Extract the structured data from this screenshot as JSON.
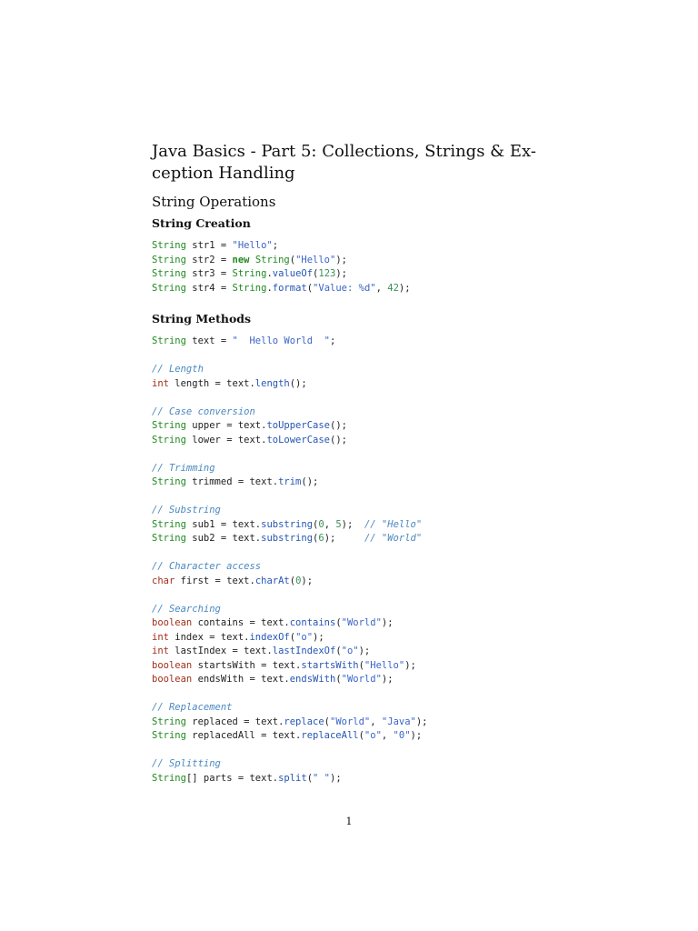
{
  "document": {
    "title_lines": [
      "Java Basics - Part 5: Collections, Strings & Ex-",
      "ception Handling"
    ],
    "section_title": "String Operations",
    "subsections": [
      {
        "heading": "String Creation",
        "code_lines": [
          [
            [
              "type",
              "String"
            ],
            [
              "pl",
              " str1 = "
            ],
            [
              "str",
              "\"Hello\""
            ],
            [
              "pl",
              ";"
            ]
          ],
          [
            [
              "type",
              "String"
            ],
            [
              "pl",
              " str2 = "
            ],
            [
              "kw",
              "new"
            ],
            [
              "pl",
              " "
            ],
            [
              "type",
              "String"
            ],
            [
              "pl",
              "("
            ],
            [
              "str",
              "\"Hello\""
            ],
            [
              "pl",
              ");"
            ]
          ],
          [
            [
              "type",
              "String"
            ],
            [
              "pl",
              " str3 = "
            ],
            [
              "type",
              "String"
            ],
            [
              "pl",
              "."
            ],
            [
              "fn",
              "valueOf"
            ],
            [
              "pl",
              "("
            ],
            [
              "num",
              "123"
            ],
            [
              "pl",
              ");"
            ]
          ],
          [
            [
              "type",
              "String"
            ],
            [
              "pl",
              " str4 = "
            ],
            [
              "type",
              "String"
            ],
            [
              "pl",
              "."
            ],
            [
              "fn",
              "format"
            ],
            [
              "pl",
              "("
            ],
            [
              "str",
              "\"Value: %d\""
            ],
            [
              "pl",
              ", "
            ],
            [
              "num",
              "42"
            ],
            [
              "pl",
              ");"
            ]
          ]
        ]
      },
      {
        "heading": "String Methods",
        "code_lines": [
          [
            [
              "type",
              "String"
            ],
            [
              "pl",
              " text = "
            ],
            [
              "str",
              "\"  Hello World  \""
            ],
            [
              "pl",
              ";"
            ]
          ],
          [],
          [
            [
              "com",
              "// Length"
            ]
          ],
          [
            [
              "prim",
              "int"
            ],
            [
              "pl",
              " length = text."
            ],
            [
              "fn",
              "length"
            ],
            [
              "pl",
              "();"
            ]
          ],
          [],
          [
            [
              "com",
              "// Case conversion"
            ]
          ],
          [
            [
              "type",
              "String"
            ],
            [
              "pl",
              " upper = text."
            ],
            [
              "fn",
              "toUpperCase"
            ],
            [
              "pl",
              "();"
            ]
          ],
          [
            [
              "type",
              "String"
            ],
            [
              "pl",
              " lower = text."
            ],
            [
              "fn",
              "toLowerCase"
            ],
            [
              "pl",
              "();"
            ]
          ],
          [],
          [
            [
              "com",
              "// Trimming"
            ]
          ],
          [
            [
              "type",
              "String"
            ],
            [
              "pl",
              " trimmed = text."
            ],
            [
              "fn",
              "trim"
            ],
            [
              "pl",
              "();"
            ]
          ],
          [],
          [
            [
              "com",
              "// Substring"
            ]
          ],
          [
            [
              "type",
              "String"
            ],
            [
              "pl",
              " sub1 = text."
            ],
            [
              "fn",
              "substring"
            ],
            [
              "pl",
              "("
            ],
            [
              "num",
              "0"
            ],
            [
              "pl",
              ", "
            ],
            [
              "num",
              "5"
            ],
            [
              "pl",
              ");  "
            ],
            [
              "com",
              "// \"Hello\""
            ]
          ],
          [
            [
              "type",
              "String"
            ],
            [
              "pl",
              " sub2 = text."
            ],
            [
              "fn",
              "substring"
            ],
            [
              "pl",
              "("
            ],
            [
              "num",
              "6"
            ],
            [
              "pl",
              ");     "
            ],
            [
              "com",
              "// \"World\""
            ]
          ],
          [],
          [
            [
              "com",
              "// Character access"
            ]
          ],
          [
            [
              "prim",
              "char"
            ],
            [
              "pl",
              " first = text."
            ],
            [
              "fn",
              "charAt"
            ],
            [
              "pl",
              "("
            ],
            [
              "num",
              "0"
            ],
            [
              "pl",
              ");"
            ]
          ],
          [],
          [
            [
              "com",
              "// Searching"
            ]
          ],
          [
            [
              "prim",
              "boolean"
            ],
            [
              "pl",
              " contains = text."
            ],
            [
              "fn",
              "contains"
            ],
            [
              "pl",
              "("
            ],
            [
              "str",
              "\"World\""
            ],
            [
              "pl",
              ");"
            ]
          ],
          [
            [
              "prim",
              "int"
            ],
            [
              "pl",
              " index = text."
            ],
            [
              "fn",
              "indexOf"
            ],
            [
              "pl",
              "("
            ],
            [
              "str",
              "\"o\""
            ],
            [
              "pl",
              ");"
            ]
          ],
          [
            [
              "prim",
              "int"
            ],
            [
              "pl",
              " lastIndex = text."
            ],
            [
              "fn",
              "lastIndexOf"
            ],
            [
              "pl",
              "("
            ],
            [
              "str",
              "\"o\""
            ],
            [
              "pl",
              ");"
            ]
          ],
          [
            [
              "prim",
              "boolean"
            ],
            [
              "pl",
              " startsWith = text."
            ],
            [
              "fn",
              "startsWith"
            ],
            [
              "pl",
              "("
            ],
            [
              "str",
              "\"Hello\""
            ],
            [
              "pl",
              ");"
            ]
          ],
          [
            [
              "prim",
              "boolean"
            ],
            [
              "pl",
              " endsWith = text."
            ],
            [
              "fn",
              "endsWith"
            ],
            [
              "pl",
              "("
            ],
            [
              "str",
              "\"World\""
            ],
            [
              "pl",
              ");"
            ]
          ],
          [],
          [
            [
              "com",
              "// Replacement"
            ]
          ],
          [
            [
              "type",
              "String"
            ],
            [
              "pl",
              " replaced = text."
            ],
            [
              "fn",
              "replace"
            ],
            [
              "pl",
              "("
            ],
            [
              "str",
              "\"World\""
            ],
            [
              "pl",
              ", "
            ],
            [
              "str",
              "\"Java\""
            ],
            [
              "pl",
              ");"
            ]
          ],
          [
            [
              "type",
              "String"
            ],
            [
              "pl",
              " replacedAll = text."
            ],
            [
              "fn",
              "replaceAll"
            ],
            [
              "pl",
              "("
            ],
            [
              "str",
              "\"o\""
            ],
            [
              "pl",
              ", "
            ],
            [
              "str",
              "\"0\""
            ],
            [
              "pl",
              ");"
            ]
          ],
          [],
          [
            [
              "com",
              "// Splitting"
            ]
          ],
          [
            [
              "type",
              "String"
            ],
            [
              "pl",
              "[] parts = text."
            ],
            [
              "fn",
              "split"
            ],
            [
              "pl",
              "("
            ],
            [
              "str",
              "\" \""
            ],
            [
              "pl",
              ");"
            ]
          ]
        ]
      }
    ],
    "page_number": "1"
  },
  "colors": {
    "type": "#1f8a1f",
    "keyword": "#1f8a1f",
    "primitive": "#a0301a",
    "string": "#3a64c8",
    "number": "#3a8f5a",
    "method": "#2655b4",
    "comment": "#4a88c0"
  }
}
